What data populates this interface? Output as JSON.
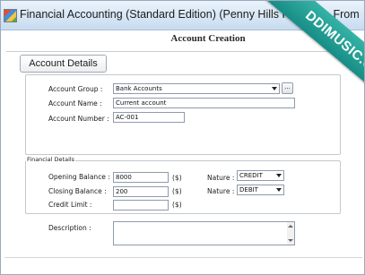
{
  "window": {
    "title": "Financial Accounting (Standard Edition) (Penny Hills Pvt. Ltd.), From",
    "watermark": "DDIMUSIC.COM"
  },
  "header": {
    "section_title": "Account Creation"
  },
  "tabs": {
    "account_details": "Account Details"
  },
  "account": {
    "group_label": "Account Group :",
    "group_value": "Bank Accounts",
    "browse_label": "...",
    "name_label": "Account Name :",
    "name_value": "Current account",
    "number_label": "Account Number :",
    "number_value": "AC-001"
  },
  "financial": {
    "group_title": "Financial Details",
    "opening_label": "Opening Balance :",
    "opening_value": "8000",
    "closing_label": "Closing Balance :",
    "closing_value": "200",
    "credit_limit_label": "Credit Limit :",
    "credit_limit_value": "",
    "currency_symbol": "($)",
    "nature_label": "Nature :",
    "opening_nature": "CREDIT",
    "closing_nature": "DEBIT"
  },
  "description": {
    "label": "Description :",
    "value": ""
  },
  "colors": {
    "titlebar": "#c7dcf0",
    "watermark_ribbon": "#1f9d94",
    "field_border": "#8e9aad"
  }
}
